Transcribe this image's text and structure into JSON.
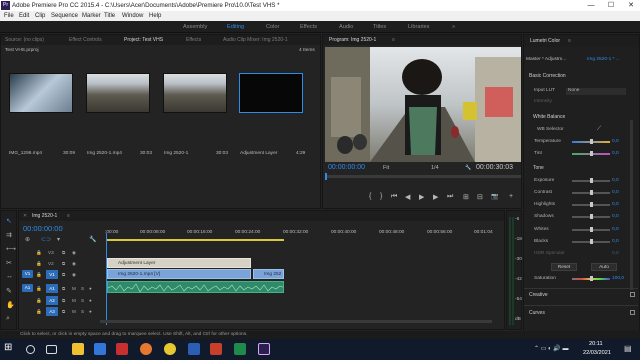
{
  "window": {
    "title": "Adobe Premiere Pro CC 2015.4 - C:\\Users\\Acer\\Documents\\Adobe\\Premiere Pro\\10.0\\Test VHS *",
    "minimize": "—",
    "maximize": "☐",
    "close": "✕"
  },
  "menu": [
    "File",
    "Edit",
    "Clip",
    "Sequence",
    "Marker",
    "Title",
    "Window",
    "Help"
  ],
  "workspaces": [
    "Assembly",
    "Editing",
    "Color",
    "Effects",
    "Audio",
    "Titles",
    "Libraries"
  ],
  "workspace_more": "»",
  "active_workspace": "Editing",
  "project_panel": {
    "tabs": [
      "Source: (no clips)",
      "Effect Controls",
      "Project: Test VHS",
      "Effects",
      "Audio Clip Mixer: Img 2520-1"
    ],
    "active_tab": "Project: Test VHS",
    "path": "Test VHS.prproj",
    "items_count": "4 Items",
    "items": [
      {
        "name": "IMG_1296.mp4",
        "duration": "30:09"
      },
      {
        "name": "Img 2520-1.mp4",
        "duration": "30:03"
      },
      {
        "name": "Img 2520-1",
        "duration": "30:03"
      },
      {
        "name": "Adjustment Layer",
        "duration": "4:29"
      }
    ]
  },
  "program_monitor": {
    "title": "Program: Img 2520-1",
    "menu_icon": "≡",
    "timecode": "00:00:00:00",
    "fit": "Fit",
    "fraction": "1/4",
    "duration": "00:00:30:03",
    "controls": [
      "⇤",
      "{",
      "}",
      "⏮",
      "◀",
      "▶",
      "▶",
      "⏭",
      "⇥",
      "⊞",
      "⊟",
      "📷",
      "+"
    ]
  },
  "lumetri": {
    "title": "Lumetri Color",
    "menu_icon": "≡",
    "master": "Master * Adjustm...",
    "sequence_clip": "Img 2520-1 * ...",
    "basic": "Basic Correction",
    "input_lut_label": "Input LUT",
    "input_lut": "None",
    "intensity_label": "Intensity",
    "white_balance": "White Balance",
    "wb_selector": "WB Selector",
    "temperature": {
      "label": "Temperature",
      "value": "0,0"
    },
    "tint": {
      "label": "Tint",
      "value": "0,0"
    },
    "tone": "Tone",
    "exposure": {
      "label": "Exposure",
      "value": "0,0"
    },
    "contrast": {
      "label": "Contrast",
      "value": "0,0"
    },
    "highlights": {
      "label": "Highlights",
      "value": "0,0"
    },
    "shadows": {
      "label": "Shadows",
      "value": "0,0"
    },
    "whites": {
      "label": "Whites",
      "value": "0,0"
    },
    "blacks": {
      "label": "Blacks",
      "value": "0,0"
    },
    "hdr": {
      "label": "HDR Specular",
      "value": "0,0"
    },
    "reset": "Reset",
    "auto": "Auto",
    "saturation": {
      "label": "Saturation",
      "value": "100,0"
    },
    "creative": "Creative",
    "curves": "Curves"
  },
  "timeline": {
    "sequence": "Img 2520-1",
    "menu_icon": "≡",
    "timecode": "00:00:00:00",
    "ruler": [
      ":00:00",
      "00:00:08:00",
      "00:00:16:00",
      "00:00:24:00",
      "00:00:32:00",
      "00:00:40:00",
      "00:00:48:00",
      "00:00:56:00",
      "00:01:04"
    ],
    "tracks": [
      "V3",
      "V2",
      "V1",
      "A1",
      "A2",
      "A3"
    ],
    "source_v": "V1",
    "source_a": "A1",
    "adjustment_clip": "Adjustment Layer",
    "clip_v1": "Img 2520-1.mp4 [V]",
    "clip_v1b": "Img 252",
    "level_scale": [
      "-6",
      "-18",
      "-30",
      "-42",
      "-54",
      "dB"
    ]
  },
  "status": "Click to select, or click in empty space and drag to marquee select. Use Shift, Alt, and Ctrl for other options.",
  "taskbar": {
    "time": "20:11",
    "date": "22/03/2021"
  },
  "colors": {
    "accent": "#2d8ceb",
    "clip_video": "#7aa3d8",
    "clip_audio": "#2e8a68",
    "adjustment": "#d6d1c4"
  }
}
